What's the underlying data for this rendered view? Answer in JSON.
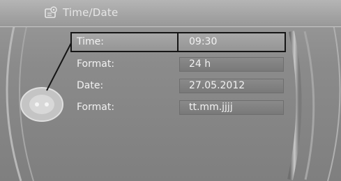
{
  "window": {
    "title": "Time/Date",
    "title_icon": "settings-icon"
  },
  "settings": [
    {
      "label": "Time:",
      "value": "09:30",
      "selected": true
    },
    {
      "label": "Format:",
      "value": "24 h",
      "selected": false
    },
    {
      "label": "Date:",
      "value": "27.05.2012",
      "selected": false
    },
    {
      "label": "Format:",
      "value": "tt.mm.jjjj",
      "selected": false
    }
  ],
  "controller": {
    "icon": "controller-knob-icon"
  },
  "colors": {
    "background": "#8e8e8e",
    "text": "#f2f2f2",
    "selection_border": "#151515"
  }
}
